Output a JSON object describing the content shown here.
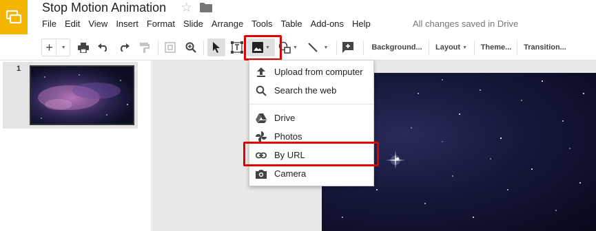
{
  "app": {
    "document_title": "Stop Motion Animation",
    "save_status": "All changes saved in Drive",
    "brand_color": "#f4b400"
  },
  "menubar": {
    "items": [
      "File",
      "Edit",
      "View",
      "Insert",
      "Format",
      "Slide",
      "Arrange",
      "Tools",
      "Table",
      "Add-ons",
      "Help"
    ]
  },
  "toolbar": {
    "icons": [
      "new-slide-icon",
      "print-icon",
      "undo-icon",
      "redo-icon",
      "paint-format-icon",
      "zoom-fit-icon",
      "zoom-icon",
      "select-icon",
      "text-box-icon",
      "image-icon",
      "shape-icon",
      "line-icon",
      "comment-icon"
    ],
    "background_label": "Background...",
    "layout_label": "Layout",
    "theme_label": "Theme...",
    "transition_label": "Transition...",
    "highlight_color": "#e00000"
  },
  "filmstrip": {
    "slides": [
      {
        "number": "1"
      }
    ]
  },
  "image_menu": {
    "items": [
      {
        "label": "Upload from computer",
        "icon": "upload-icon"
      },
      {
        "label": "Search the web",
        "icon": "search-icon"
      },
      {
        "label": "Drive",
        "icon": "drive-icon"
      },
      {
        "label": "Photos",
        "icon": "photos-icon"
      },
      {
        "label": "By URL",
        "icon": "link-icon"
      },
      {
        "label": "Camera",
        "icon": "camera-icon"
      }
    ]
  }
}
